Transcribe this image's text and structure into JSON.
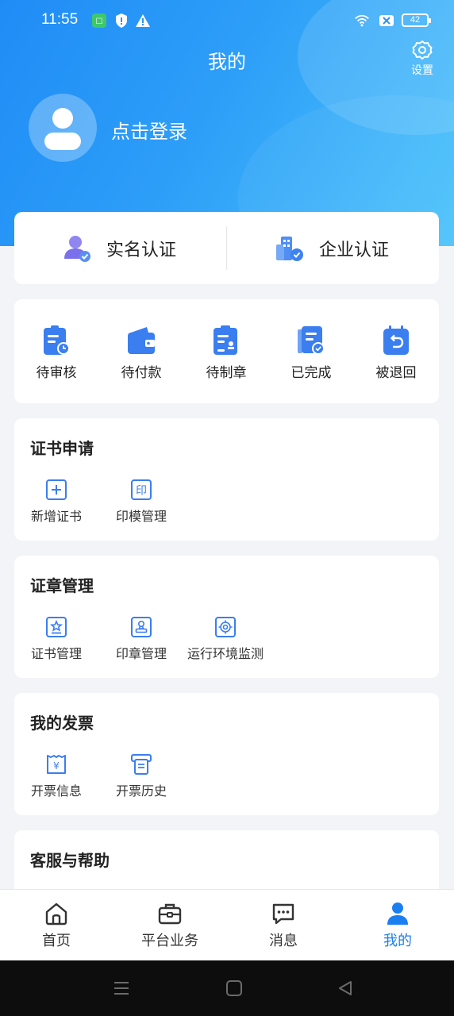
{
  "colors": {
    "primary": "#1b7ff0",
    "header_start": "#1f8cf6",
    "header_end": "#4cc3fb",
    "icon_blue": "#3a7ef0"
  },
  "status_bar": {
    "time": "11:55",
    "battery": "42",
    "icons": [
      "app-icon",
      "shield-icon",
      "warning-icon",
      "wifi-icon",
      "sim-off-icon",
      "battery-icon"
    ]
  },
  "header": {
    "title": "我的",
    "settings_label": "设置",
    "login_text": "点击登录"
  },
  "auth": {
    "real_name": "实名认证",
    "enterprise": "企业认证"
  },
  "order_status": [
    "待审核",
    "待付款",
    "待制章",
    "已完成",
    "被退回"
  ],
  "sections": {
    "cert_apply": {
      "title": "证书申请",
      "items": [
        "新增证书",
        "印模管理"
      ]
    },
    "seal_manage": {
      "title": "证章管理",
      "items": [
        "证书管理",
        "印章管理",
        "运行环境监测"
      ]
    },
    "invoice": {
      "title": "我的发票",
      "items": [
        "开票信息",
        "开票历史"
      ]
    },
    "help": {
      "title": "客服与帮助"
    }
  },
  "tabbar": {
    "tabs": [
      "首页",
      "平台业务",
      "消息",
      "我的"
    ],
    "active": "我的"
  }
}
